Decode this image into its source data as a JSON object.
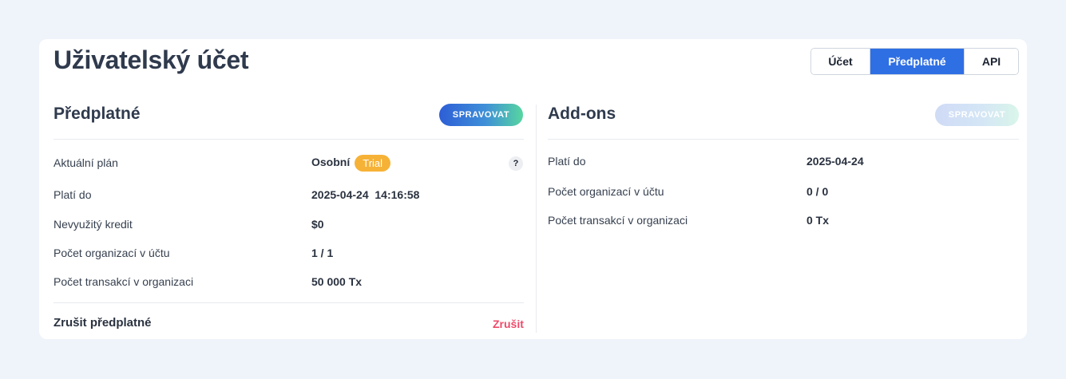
{
  "page": {
    "title": "Uživatelský účet"
  },
  "tabs": [
    {
      "label": "Účet",
      "active": false
    },
    {
      "label": "Předplatné",
      "active": true
    },
    {
      "label": "API",
      "active": false
    }
  ],
  "subscription": {
    "title": "Předplatné",
    "manage_label": "SPRAVOVAT",
    "plan_label": "Aktuální plán",
    "plan_value": "Osobní",
    "plan_badge": "Trial",
    "help_icon": "?",
    "valid_label": "Platí do",
    "valid_value": "2025-04-24  14:16:58",
    "credit_label": "Nevyužitý kredit",
    "credit_value": "$0",
    "orgs_label": "Počet organizací v účtu",
    "orgs_value": "1 / 1",
    "tx_label": "Počet transakcí v organizaci",
    "tx_value": "50 000 Tx",
    "cancel_title": "Zrušit předplatné",
    "cancel_link": "Zrušit"
  },
  "addons": {
    "title": "Add-ons",
    "manage_label": "SPRAVOVAT",
    "manage_disabled": true,
    "valid_label": "Platí do",
    "valid_value": "2025-04-24",
    "orgs_label": "Počet organizací v účtu",
    "orgs_value": "0 / 0",
    "tx_label": "Počet transakcí v organizaci",
    "tx_value": "0 Tx"
  },
  "colors": {
    "accent": "#2f6fe4",
    "badge": "#f6b236",
    "danger": "#ef4a6a",
    "background": "#eff4fb"
  }
}
